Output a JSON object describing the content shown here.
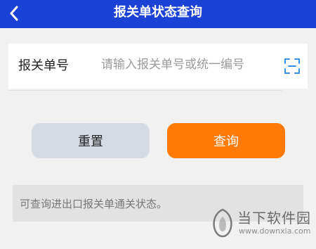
{
  "header": {
    "title": "报关单状态查询",
    "back_icon": "chevron-left-icon"
  },
  "form": {
    "label": "报关单号",
    "input_value": "",
    "input_placeholder": "请输入报关单号或统一编号",
    "scan_icon": "scan-icon"
  },
  "actions": {
    "reset_label": "重置",
    "query_label": "查询"
  },
  "notice": {
    "text": "可查询进出口报关单通关状态。"
  },
  "watermark": {
    "name": "当下软件园",
    "url": "www.downxia.com"
  },
  "colors": {
    "header": "#1b41d6",
    "query_button": "#ff7a08",
    "reset_button": "#d5dae3",
    "scan_icon": "#3a8ee6"
  }
}
